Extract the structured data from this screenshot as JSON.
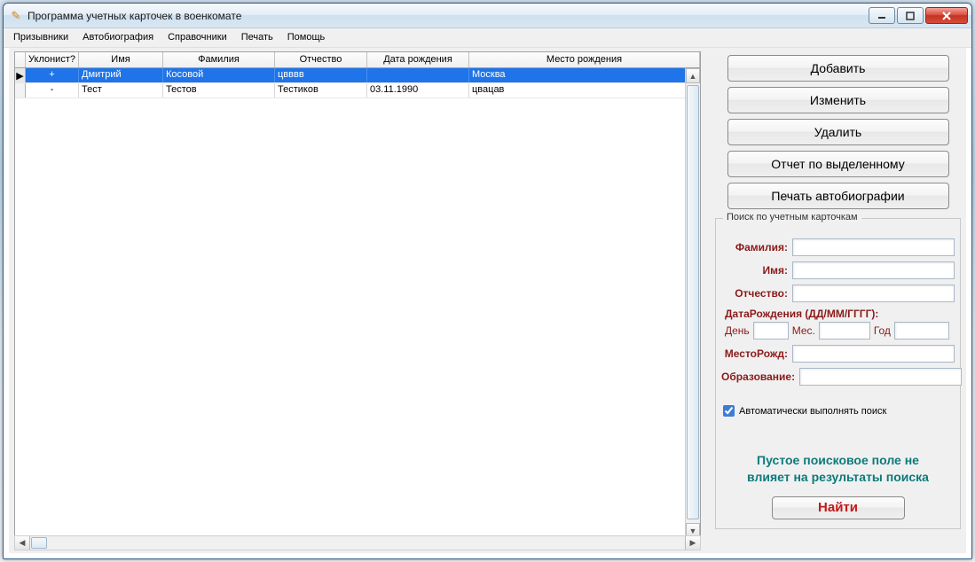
{
  "window": {
    "title": "Программа учетных карточек в военкомате"
  },
  "menubar": {
    "items": [
      "Призывники",
      "Автобиография",
      "Справочники",
      "Печать",
      "Помощь"
    ]
  },
  "grid": {
    "headers": {
      "uklonist": "Уклонист?",
      "name": "Имя",
      "surname": "Фамилия",
      "patronymic": "Отчество",
      "dob": "Дата рождения",
      "birthplace": "Место рождения"
    },
    "rows": [
      {
        "selected": true,
        "marker": "▶",
        "uklonist": "+",
        "name": "Дмитрий",
        "surname": "Косовой",
        "patronymic": "цвввв",
        "dob": "",
        "birthplace": "Москва"
      },
      {
        "selected": false,
        "marker": "",
        "uklonist": "-",
        "name": "Тест",
        "surname": "Тестов",
        "patronymic": "Тестиков",
        "dob": "03.11.1990",
        "birthplace": "цвацав"
      }
    ]
  },
  "actions": {
    "add": "Добавить",
    "edit": "Изменить",
    "delete": "Удалить",
    "report_selected": "Отчет по выделенному",
    "print_bio": "Печать автобиографии"
  },
  "search": {
    "group_title": "Поиск по учетным карточкам",
    "labels": {
      "surname": "Фамилия:",
      "name": "Имя:",
      "patronymic": "Отчество:",
      "dob_header": "ДатаРождения (ДД/ММ/ГГГГ):",
      "day": "День",
      "month": "Мес.",
      "year": "Год",
      "birthplace": "МестоРожд:",
      "education": "Образование:"
    },
    "auto_search_label": "Автоматически выполнять поиск",
    "auto_search_checked": true,
    "hint_line1": "Пустое поисковое поле не",
    "hint_line2": "влияет на результаты поиска",
    "find_label": "Найти"
  }
}
